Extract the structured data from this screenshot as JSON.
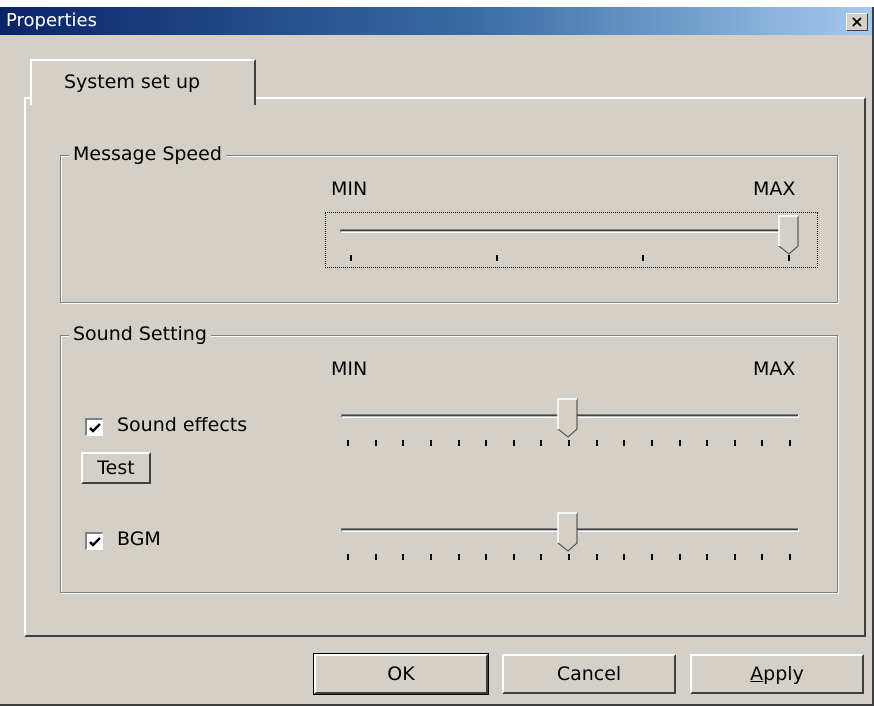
{
  "window": {
    "title": "Properties",
    "close_glyph": "×"
  },
  "tabs": [
    {
      "label": "System set up",
      "selected": true
    }
  ],
  "message_speed": {
    "group_label": "Message Speed",
    "min_label": "MIN",
    "max_label": "MAX",
    "level": 1.0
  },
  "sound_setting": {
    "group_label": "Sound Setting",
    "min_label": "MIN",
    "max_label": "MAX",
    "sound_effects": {
      "label": "Sound effects",
      "checked": true,
      "level": 0.5
    },
    "test_button": "Test",
    "bgm": {
      "label": "BGM",
      "checked": true,
      "level": 0.5
    }
  },
  "buttons": {
    "ok": "OK",
    "cancel": "Cancel",
    "apply": "Apply",
    "apply_mnemonic": "A"
  },
  "icons": {
    "close": "close-icon",
    "check": "checkmark-icon"
  }
}
